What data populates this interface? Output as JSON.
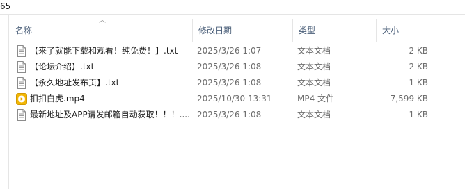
{
  "address": {
    "text": "65"
  },
  "columns": {
    "name": "名称",
    "date": "修改日期",
    "type": "类型",
    "size": "大小"
  },
  "files": [
    {
      "name": "【来了就能下载和观看！纯免费！】.txt",
      "date": "2025/3/26 1:07",
      "type": "文本文档",
      "size": "2 KB",
      "icon": "text-file-icon"
    },
    {
      "name": "【论坛介绍】.txt",
      "date": "2025/3/26 1:08",
      "type": "文本文档",
      "size": "2 KB",
      "icon": "text-file-icon"
    },
    {
      "name": "【永久地址发布页】.txt",
      "date": "2025/3/26 1:08",
      "type": "文本文档",
      "size": "1 KB",
      "icon": "text-file-icon"
    },
    {
      "name": "扣扣白虎.mp4",
      "date": "2025/10/30 13:31",
      "type": "MP4 文件",
      "size": "7,599 KB",
      "icon": "video-file-icon"
    },
    {
      "name": "最新地址及APP请发邮箱自动获取！！！....",
      "date": "2025/3/26 1:08",
      "type": "文本文档",
      "size": "1 KB",
      "icon": "text-file-icon"
    }
  ]
}
